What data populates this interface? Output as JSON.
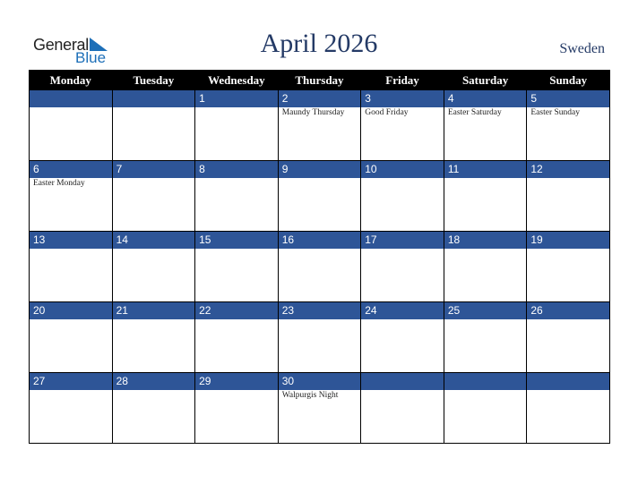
{
  "logo": {
    "line1": "General",
    "line2": "Blue",
    "icon": "triangle-flag-icon"
  },
  "header": {
    "title": "April 2026",
    "country": "Sweden"
  },
  "colors": {
    "header_bg": "#000000",
    "date_bar": "#2e5597",
    "title": "#243a66",
    "logo_blue": "#1d6fb8"
  },
  "weekdays": [
    "Monday",
    "Tuesday",
    "Wednesday",
    "Thursday",
    "Friday",
    "Saturday",
    "Sunday"
  ],
  "weeks": [
    [
      {
        "date": "",
        "event": ""
      },
      {
        "date": "",
        "event": ""
      },
      {
        "date": "1",
        "event": ""
      },
      {
        "date": "2",
        "event": "Maundy Thursday"
      },
      {
        "date": "3",
        "event": "Good Friday"
      },
      {
        "date": "4",
        "event": "Easter Saturday"
      },
      {
        "date": "5",
        "event": "Easter Sunday"
      }
    ],
    [
      {
        "date": "6",
        "event": "Easter Monday"
      },
      {
        "date": "7",
        "event": ""
      },
      {
        "date": "8",
        "event": ""
      },
      {
        "date": "9",
        "event": ""
      },
      {
        "date": "10",
        "event": ""
      },
      {
        "date": "11",
        "event": ""
      },
      {
        "date": "12",
        "event": ""
      }
    ],
    [
      {
        "date": "13",
        "event": ""
      },
      {
        "date": "14",
        "event": ""
      },
      {
        "date": "15",
        "event": ""
      },
      {
        "date": "16",
        "event": ""
      },
      {
        "date": "17",
        "event": ""
      },
      {
        "date": "18",
        "event": ""
      },
      {
        "date": "19",
        "event": ""
      }
    ],
    [
      {
        "date": "20",
        "event": ""
      },
      {
        "date": "21",
        "event": ""
      },
      {
        "date": "22",
        "event": ""
      },
      {
        "date": "23",
        "event": ""
      },
      {
        "date": "24",
        "event": ""
      },
      {
        "date": "25",
        "event": ""
      },
      {
        "date": "26",
        "event": ""
      }
    ],
    [
      {
        "date": "27",
        "event": ""
      },
      {
        "date": "28",
        "event": ""
      },
      {
        "date": "29",
        "event": ""
      },
      {
        "date": "30",
        "event": "Walpurgis Night"
      },
      {
        "date": "",
        "event": ""
      },
      {
        "date": "",
        "event": ""
      },
      {
        "date": "",
        "event": ""
      }
    ]
  ]
}
